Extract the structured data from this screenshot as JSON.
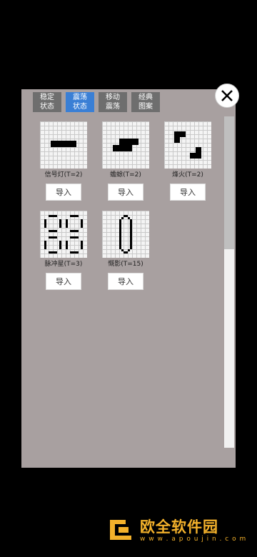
{
  "tabs": [
    {
      "line1": "稳定",
      "line2": "状态"
    },
    {
      "line1": "震荡",
      "line2": "状态"
    },
    {
      "line1": "移动",
      "line2": "震荡"
    },
    {
      "line1": "经典",
      "line2": "图案"
    }
  ],
  "close_label": "X",
  "items": [
    {
      "label": "信号灯(T=2)",
      "button": "导入"
    },
    {
      "label": "蟾蜍(T=2)",
      "button": "导入"
    },
    {
      "label": "烽火(T=2)",
      "button": "导入"
    },
    {
      "label": "脉冲星(T=3)",
      "button": "导入"
    },
    {
      "label": "慨影(T=15)",
      "button": "导入"
    }
  ],
  "watermark": {
    "text": "欧全软件园",
    "url": "w w w . a p o u j i n . c o m"
  },
  "colors": {
    "tab_active": "#3a7fd5",
    "tab_inactive": "#6e6e6e",
    "panel": "#a8a0a0",
    "watermark": "#f3b12b"
  }
}
